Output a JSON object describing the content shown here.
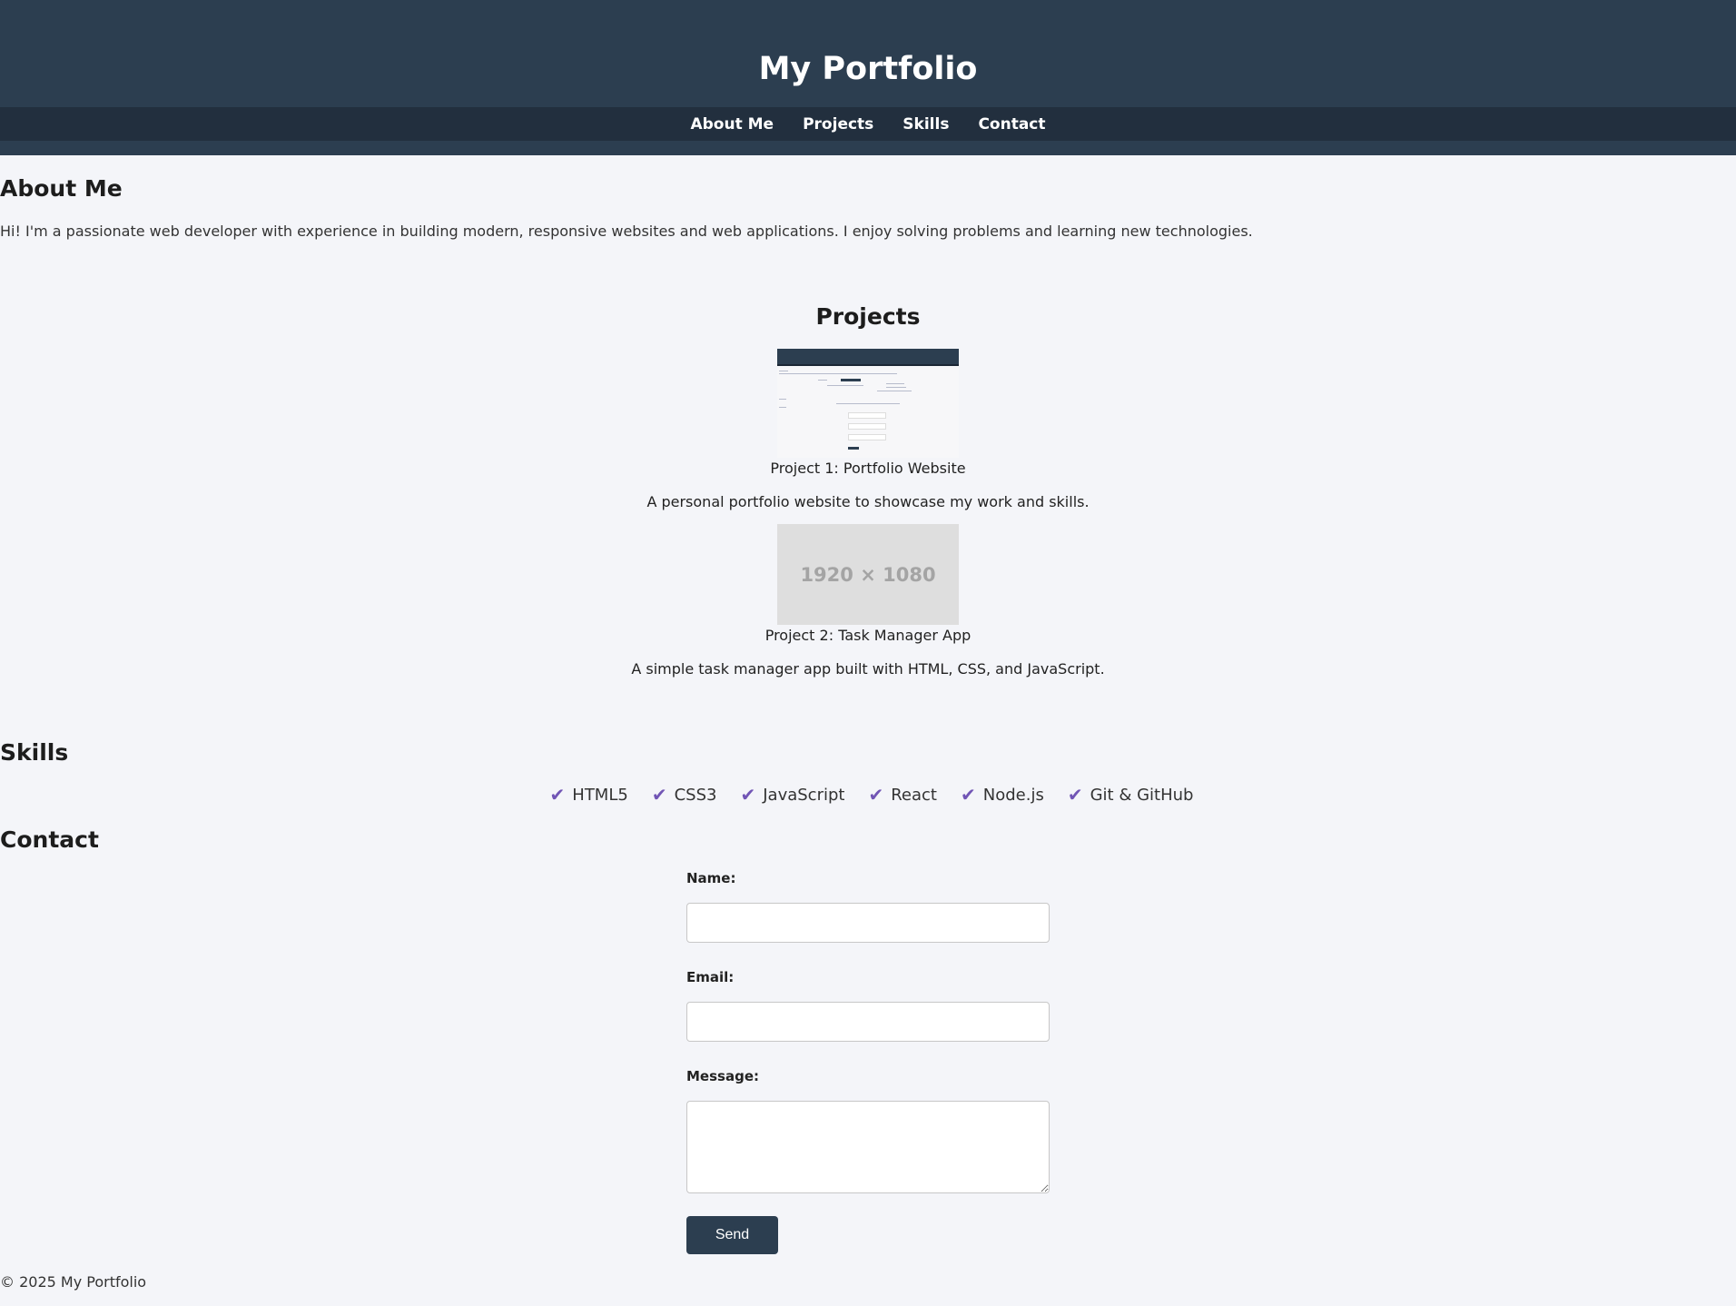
{
  "header": {
    "title": "My Portfolio",
    "nav": [
      "About Me",
      "Projects",
      "Skills",
      "Contact"
    ]
  },
  "about": {
    "heading": "About Me",
    "text": "Hi! I'm a passionate web developer with experience in building modern, responsive websites and web applications. I enjoy solving problems and learning new technologies."
  },
  "projects": {
    "heading": "Projects",
    "items": [
      {
        "caption": "Project 1: Portfolio Website",
        "description": "A personal portfolio website to showcase my work and skills."
      },
      {
        "caption": "Project 2: Task Manager App",
        "description": "A simple task manager app built with HTML, CSS, and JavaScript.",
        "placeholder": "1920 × 1080"
      }
    ]
  },
  "skills": {
    "heading": "Skills",
    "check_icon": "check-icon",
    "items": [
      "HTML5",
      "CSS3",
      "JavaScript",
      "React",
      "Node.js",
      "Git & GitHub"
    ]
  },
  "contact": {
    "heading": "Contact",
    "name_label": "Name:",
    "email_label": "Email:",
    "message_label": "Message:",
    "send_label": "Send"
  },
  "footer": {
    "text": "© 2025 My Portfolio"
  },
  "colors": {
    "header_bg": "#2c3e50",
    "nav_bg": "#222f3e",
    "accent": "#7155b5",
    "page_bg": "#f4f5f9"
  }
}
